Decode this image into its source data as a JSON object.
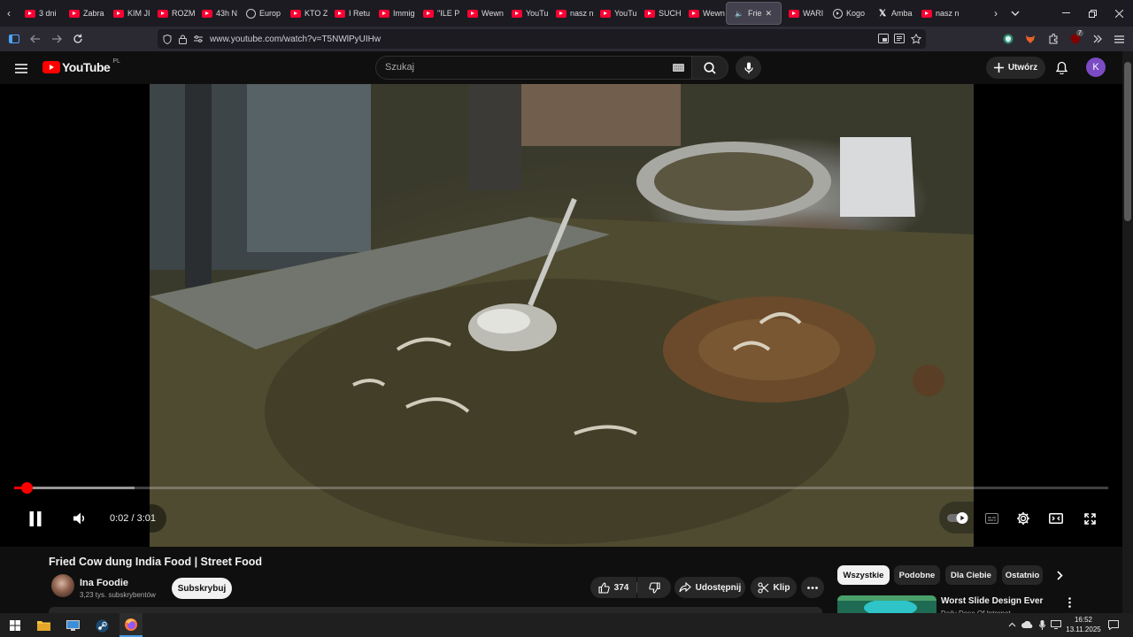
{
  "tabs": [
    {
      "label": "3 dni",
      "icon": "youtube-favicon-icon"
    },
    {
      "label": "Zabra",
      "icon": "youtube-favicon-icon"
    },
    {
      "label": "KIM JI",
      "icon": "youtube-favicon-icon"
    },
    {
      "label": "ROZM",
      "icon": "youtube-favicon-icon"
    },
    {
      "label": "43h N",
      "icon": "youtube-favicon-icon"
    },
    {
      "label": "Europ",
      "icon": "globe-icon"
    },
    {
      "label": "KTO Z",
      "icon": "youtube-favicon-icon"
    },
    {
      "label": "I Retu",
      "icon": "youtube-favicon-icon"
    },
    {
      "label": "Immig",
      "icon": "youtube-favicon-icon"
    },
    {
      "label": "\"ILE P",
      "icon": "youtube-favicon-icon"
    },
    {
      "label": "Wewn",
      "icon": "youtube-favicon-icon"
    },
    {
      "label": "YouTu",
      "icon": "youtube-favicon-icon"
    },
    {
      "label": "nasz n",
      "icon": "youtube-favicon-icon"
    },
    {
      "label": "YouTu",
      "icon": "youtube-favicon-icon"
    },
    {
      "label": "SUCH",
      "icon": "youtube-favicon-icon"
    },
    {
      "label": "Wewn",
      "icon": "youtube-favicon-icon"
    },
    {
      "label": "Frie",
      "icon": "speaker-icon",
      "active": true
    },
    {
      "label": "WARI",
      "icon": "youtube-favicon-icon"
    },
    {
      "label": "Kogo",
      "icon": "play-circle-icon"
    },
    {
      "label": "Amba",
      "icon": "x-logo-icon"
    },
    {
      "label": "nasz n",
      "icon": "youtube-favicon-icon"
    }
  ],
  "browser": {
    "url": "www.youtube.com/watch?v=T5NWlPyUIHw",
    "extension_badge": "7"
  },
  "youtube": {
    "logo_text": "YouTube",
    "region": "PL",
    "search_placeholder": "Szukaj",
    "create_label": "Utwórz",
    "avatar_letter": "K"
  },
  "player": {
    "time_current": "0:02",
    "time_separator": " / ",
    "time_total": "3:01",
    "played_fraction": 0.011,
    "buffered_fraction": 0.11
  },
  "video": {
    "title": "Fried Cow dung India Food | Street Food",
    "channel": "Ina Foodie",
    "subscribers": "3,23 tys. subskrybentów",
    "subscribe_label": "Subskrybuj",
    "likes": "374",
    "share_label": "Udostępnij",
    "clip_label": "Klip"
  },
  "chips": [
    "Wszystkie",
    "Podobne",
    "Dla Ciebie",
    "Ostatnio"
  ],
  "related": {
    "title": "Worst Slide Design Ever",
    "channel": "Daily Dose Of Internet"
  },
  "taskbar": {
    "time": "16:52",
    "date": "13.11.2025"
  },
  "colors": {
    "accent_red": "#ff0000",
    "background": "#0f0f0f",
    "avatar": "#7b4bc4"
  }
}
